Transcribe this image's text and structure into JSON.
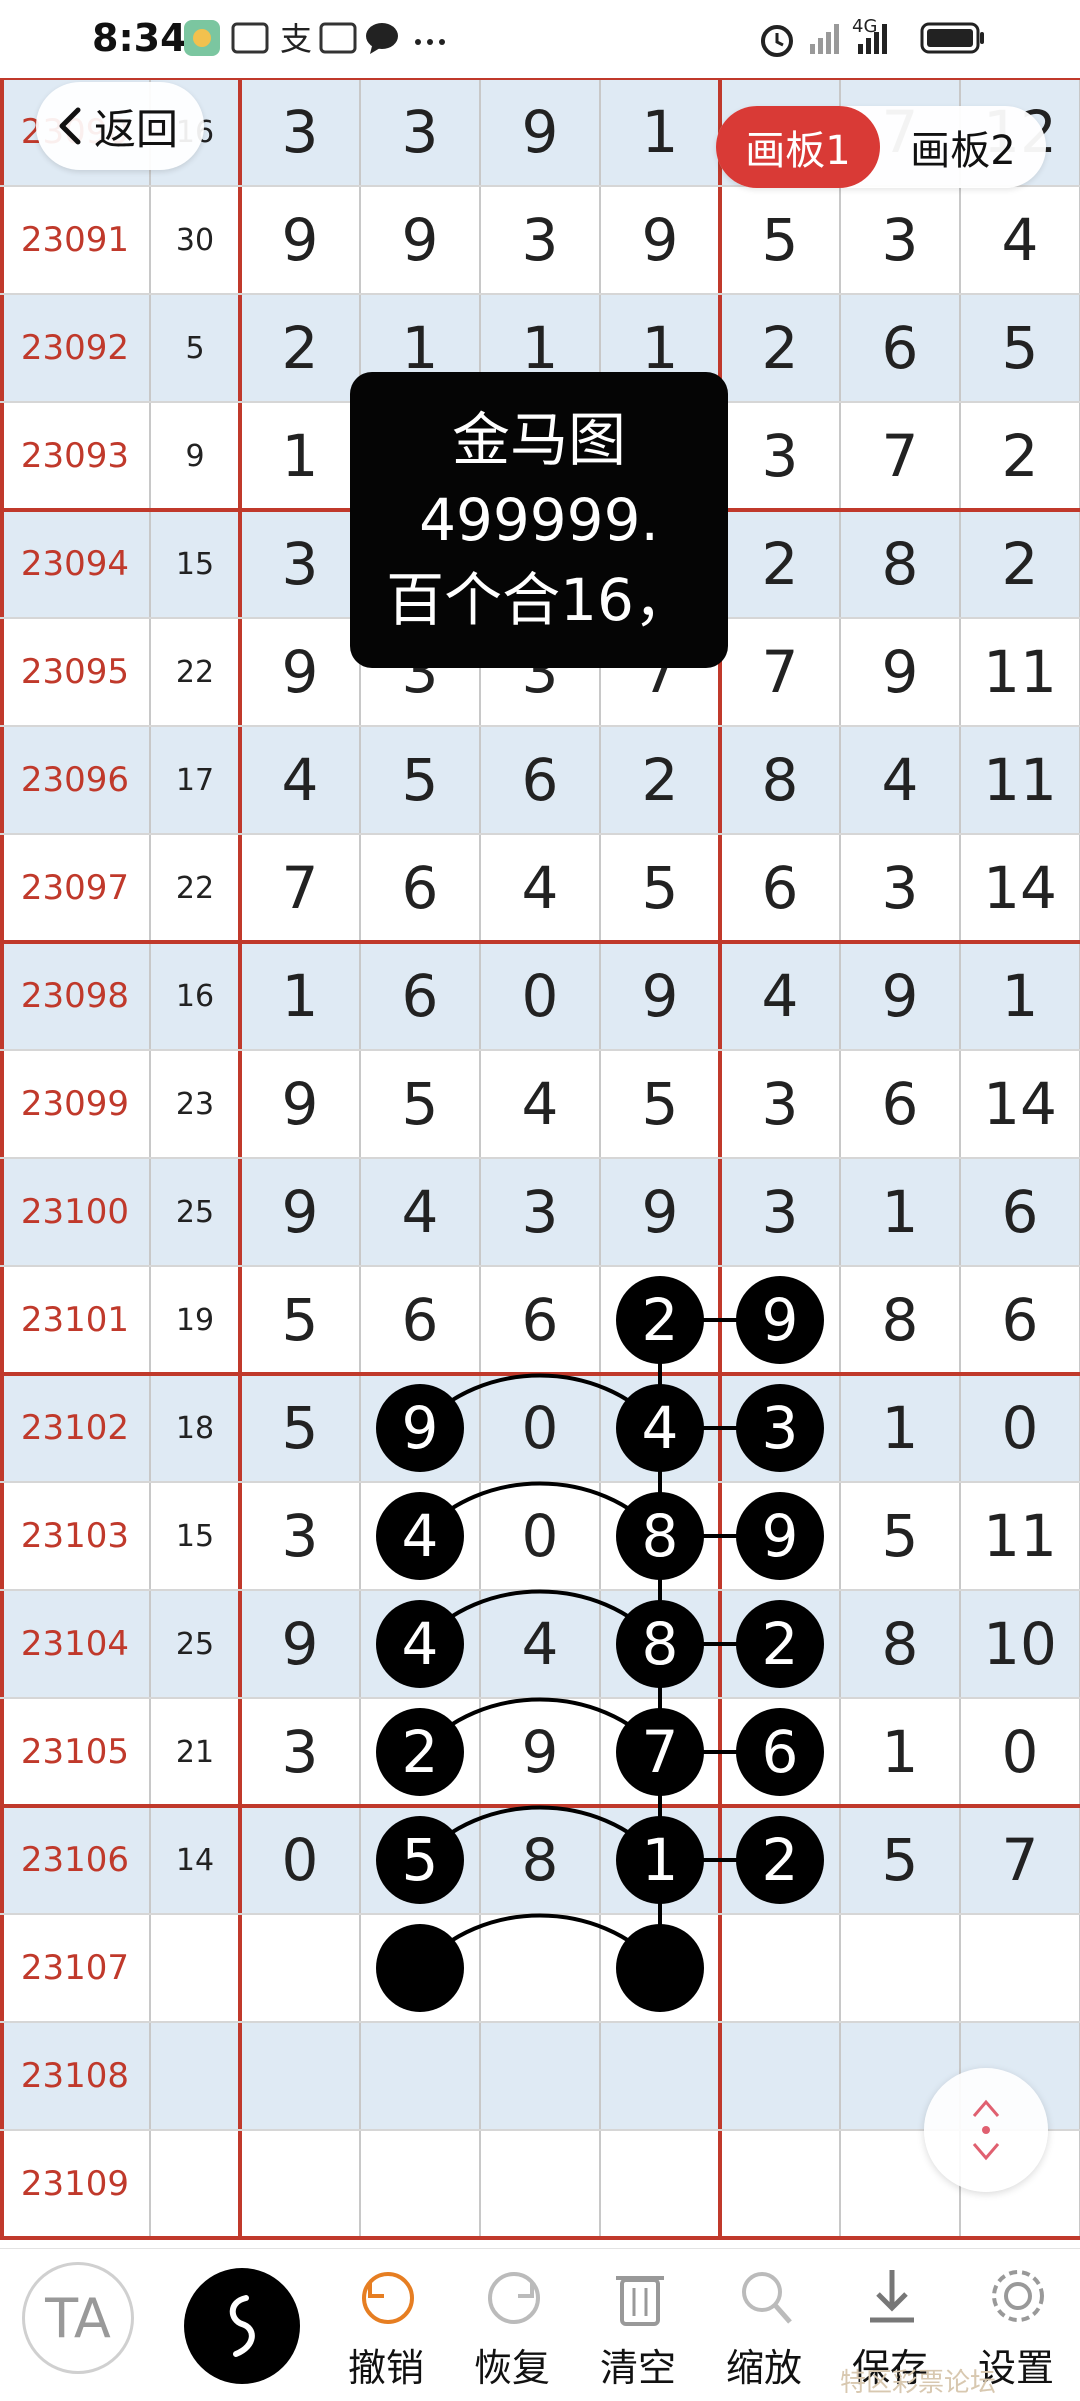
{
  "status_bar": {
    "time": "8:34",
    "network": "4G"
  },
  "back": {
    "label": "返回"
  },
  "tabs": [
    {
      "label": "画板1",
      "active": true
    },
    {
      "label": "画板2",
      "active": false
    }
  ],
  "note": {
    "lines": [
      "金马图",
      "499999.",
      "百个合16，"
    ]
  },
  "toolbar": {
    "items": [
      {
        "id": "undo",
        "label": "撤销",
        "icon": "undo-icon"
      },
      {
        "id": "redo",
        "label": "恢复",
        "icon": "redo-icon"
      },
      {
        "id": "clear",
        "label": "清空",
        "icon": "trash-icon"
      },
      {
        "id": "zoom",
        "label": "缩放",
        "icon": "zoom-icon"
      },
      {
        "id": "save",
        "label": "保存",
        "icon": "download-icon"
      },
      {
        "id": "settings",
        "label": "设置",
        "icon": "gear-icon"
      }
    ],
    "text_tool_glyph": "TA"
  },
  "watermark": "特区彩票论坛",
  "colors": {
    "accent": "#d93a36",
    "date_text": "#c0392b",
    "grid_line": "#c0392b",
    "row_alt": "#dfeaf4",
    "circle": "#000000"
  },
  "grid": {
    "rows": [
      {
        "id": "23090",
        "sum": "16",
        "nums": [
          "3",
          "3",
          "9",
          "1",
          "",
          "7",
          "12"
        ]
      },
      {
        "id": "23091",
        "sum": "30",
        "nums": [
          "9",
          "9",
          "3",
          "9",
          "5",
          "3",
          "4"
        ]
      },
      {
        "id": "23092",
        "sum": "5",
        "nums": [
          "2",
          "1",
          "1",
          "1",
          "2",
          "6",
          "5"
        ]
      },
      {
        "id": "23093",
        "sum": "9",
        "nums": [
          "1",
          "",
          "",
          "",
          "3",
          "7",
          "2"
        ]
      },
      {
        "id": "23094",
        "sum": "15",
        "nums": [
          "3",
          "",
          "",
          "",
          "2",
          "8",
          "2"
        ]
      },
      {
        "id": "23095",
        "sum": "22",
        "nums": [
          "9",
          "3",
          "3",
          "7",
          "7",
          "9",
          "11"
        ]
      },
      {
        "id": "23096",
        "sum": "17",
        "nums": [
          "4",
          "5",
          "6",
          "2",
          "8",
          "4",
          "11"
        ]
      },
      {
        "id": "23097",
        "sum": "22",
        "nums": [
          "7",
          "6",
          "4",
          "5",
          "6",
          "3",
          "14"
        ]
      },
      {
        "id": "23098",
        "sum": "16",
        "nums": [
          "1",
          "6",
          "0",
          "9",
          "4",
          "9",
          "1"
        ]
      },
      {
        "id": "23099",
        "sum": "23",
        "nums": [
          "9",
          "5",
          "4",
          "5",
          "3",
          "6",
          "14"
        ]
      },
      {
        "id": "23100",
        "sum": "25",
        "nums": [
          "9",
          "4",
          "3",
          "9",
          "3",
          "1",
          "6"
        ]
      },
      {
        "id": "23101",
        "sum": "19",
        "nums": [
          "5",
          "6",
          "6",
          "2",
          "9",
          "8",
          "6"
        ]
      },
      {
        "id": "23102",
        "sum": "18",
        "nums": [
          "5",
          "9",
          "0",
          "4",
          "3",
          "1",
          "0"
        ]
      },
      {
        "id": "23103",
        "sum": "15",
        "nums": [
          "3",
          "4",
          "0",
          "8",
          "9",
          "5",
          "11"
        ]
      },
      {
        "id": "23104",
        "sum": "25",
        "nums": [
          "9",
          "4",
          "4",
          "8",
          "2",
          "8",
          "10"
        ]
      },
      {
        "id": "23105",
        "sum": "21",
        "nums": [
          "3",
          "2",
          "9",
          "7",
          "6",
          "1",
          "0"
        ]
      },
      {
        "id": "23106",
        "sum": "14",
        "nums": [
          "0",
          "5",
          "8",
          "1",
          "2",
          "5",
          "7"
        ]
      },
      {
        "id": "23107",
        "sum": "",
        "nums": [
          "",
          "",
          "",
          "",
          "",
          "",
          ""
        ]
      },
      {
        "id": "23108",
        "sum": "",
        "nums": [
          "",
          "",
          "",
          "",
          "",
          "",
          ""
        ]
      },
      {
        "id": "23109",
        "sum": "",
        "nums": [
          "",
          "",
          "",
          "",
          "",
          "",
          ""
        ]
      }
    ],
    "circled": [
      [
        11,
        3
      ],
      [
        11,
        4
      ],
      [
        12,
        1
      ],
      [
        12,
        3
      ],
      [
        12,
        4
      ],
      [
        13,
        1
      ],
      [
        13,
        3
      ],
      [
        13,
        4
      ],
      [
        14,
        1
      ],
      [
        14,
        3
      ],
      [
        14,
        4
      ],
      [
        15,
        1
      ],
      [
        15,
        3
      ],
      [
        15,
        4
      ],
      [
        16,
        1
      ],
      [
        16,
        3
      ],
      [
        16,
        4
      ],
      [
        17,
        1
      ],
      [
        17,
        3
      ]
    ]
  }
}
